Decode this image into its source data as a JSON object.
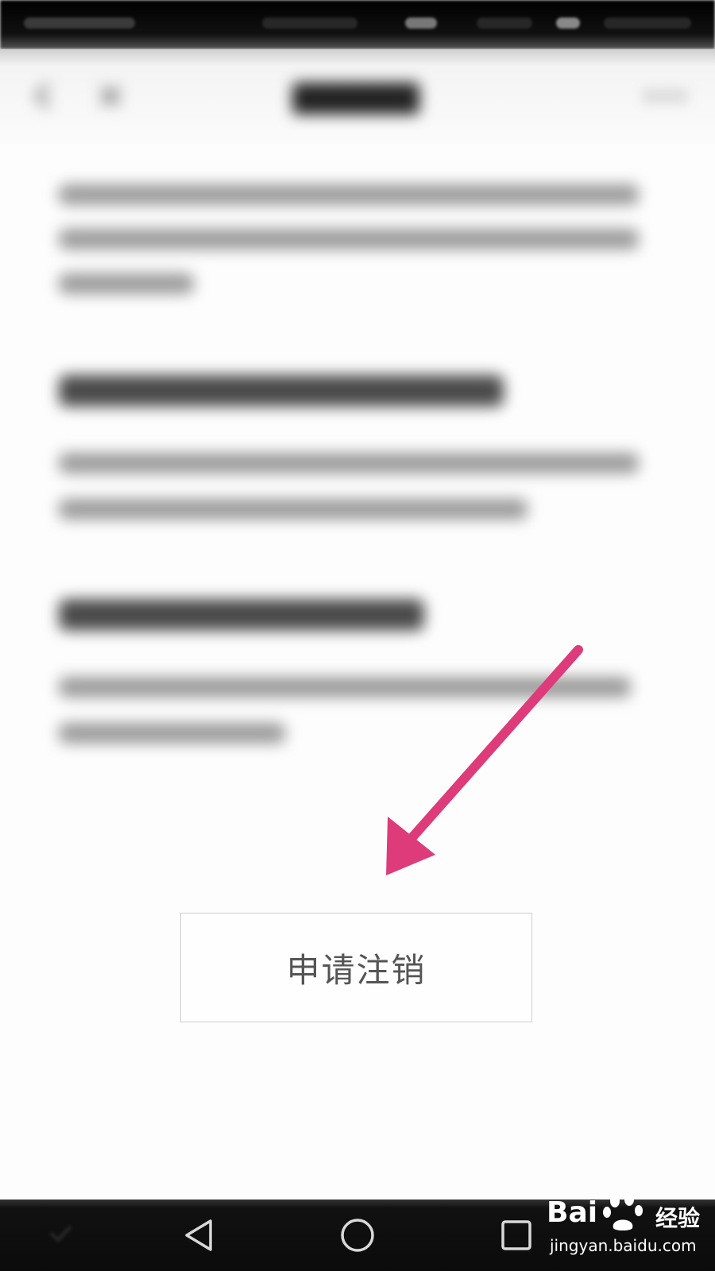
{
  "main": {
    "apply_button_label": "申请注销"
  },
  "icons": {
    "header_back": "back-arrow-icon",
    "header_close": "close-icon",
    "header_more": "more-icon",
    "nav_back": "triangle-back-icon",
    "nav_home": "circle-home-icon",
    "nav_recents": "square-recents-icon"
  },
  "annotation": {
    "arrow_color": "#dd3b7a"
  },
  "watermark": {
    "brand_a": "Bai",
    "brand_b": "经验",
    "url": "jingyan.baidu.com"
  }
}
